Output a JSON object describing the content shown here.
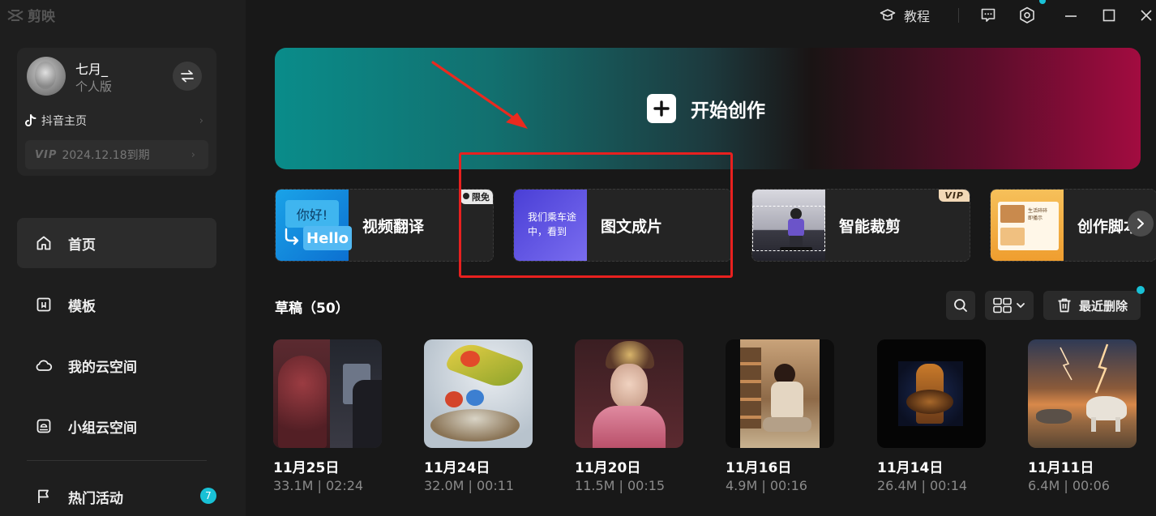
{
  "app": {
    "logo_text": "剪映"
  },
  "user": {
    "name": "七月_",
    "edition": "个人版",
    "douyin_label": "抖音主页",
    "vip_label": "VIP",
    "vip_expiry": "2024.12.18到期"
  },
  "nav": {
    "items": [
      {
        "label": "首页",
        "icon": "home-icon",
        "active": true
      },
      {
        "label": "模板",
        "icon": "template-icon",
        "active": false
      },
      {
        "label": "我的云空间",
        "icon": "cloud-icon",
        "active": false
      },
      {
        "label": "小组云空间",
        "icon": "group-cloud-icon",
        "active": false
      },
      {
        "label": "热门活动",
        "icon": "flag-icon",
        "active": false,
        "badge": "7"
      }
    ]
  },
  "topbar": {
    "tutorial_label": "教程"
  },
  "hero": {
    "cta_label": "开始创作"
  },
  "features": [
    {
      "label": "视频翻译",
      "tag": "限免",
      "thumb_text_a": "你好!",
      "thumb_text_b": "Hello"
    },
    {
      "label": "图文成片",
      "tag": "",
      "thumb_text_a": "我们乘车途",
      "thumb_text_b": "中，看到"
    },
    {
      "label": "智能裁剪",
      "tag": "VIP"
    },
    {
      "label": "创作脚本",
      "tag": "",
      "thumb_text_a": "生活碎碎",
      "thumb_text_b": "即播示"
    }
  ],
  "drafts": {
    "title": "草稿（50）",
    "recent_delete_label": "最近删除",
    "items": [
      {
        "date": "11月25日",
        "meta": "33.1M | 02:24"
      },
      {
        "date": "11月24日",
        "meta": "32.0M | 00:11"
      },
      {
        "date": "11月20日",
        "meta": "11.5M | 00:15"
      },
      {
        "date": "11月16日",
        "meta": "4.9M | 00:16"
      },
      {
        "date": "11月14日",
        "meta": "26.4M | 00:14"
      },
      {
        "date": "11月11日",
        "meta": "6.4M | 00:06"
      }
    ]
  },
  "colors": {
    "accent": "#19c1d6",
    "highlight": "#e8201f",
    "sidebar": "#1e1e1e",
    "background": "#181818"
  }
}
